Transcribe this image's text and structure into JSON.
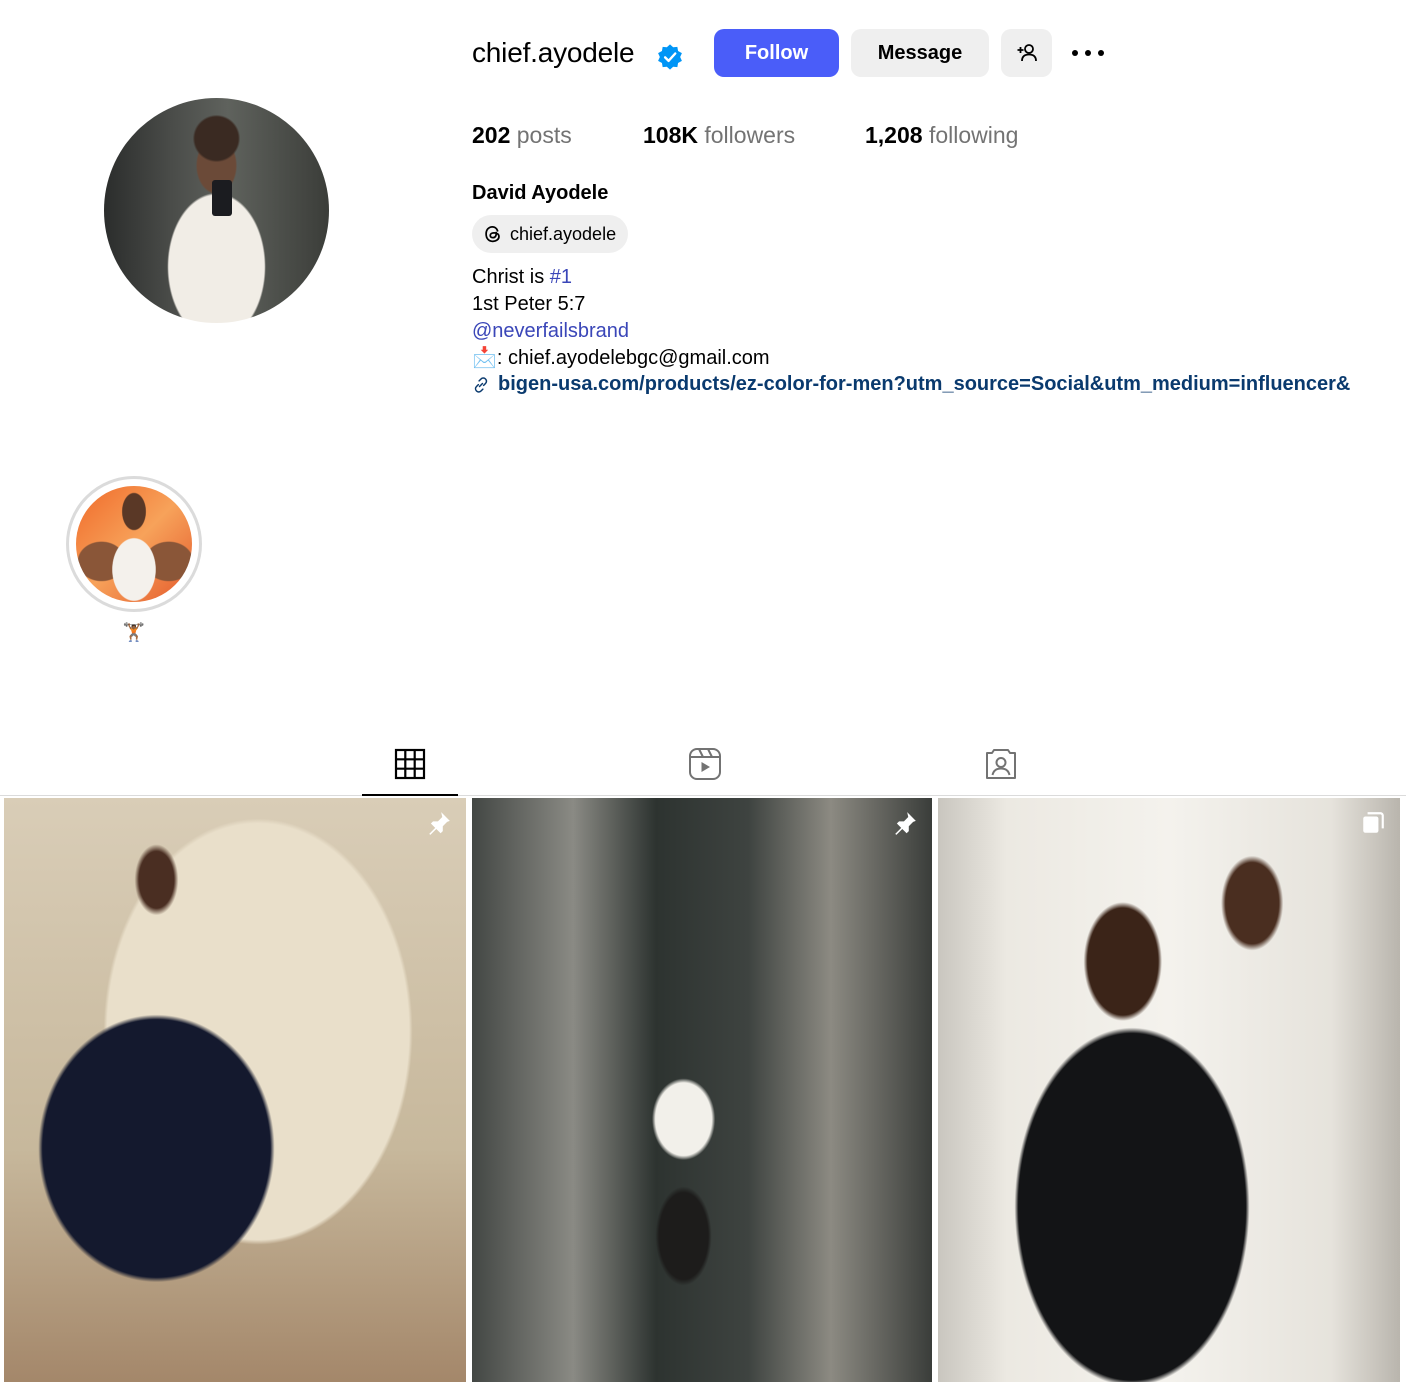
{
  "profile": {
    "username": "chief.ayodele",
    "full_name": "David Ayodele",
    "threads_handle": "chief.ayodele",
    "stats": {
      "posts_count": "202",
      "posts_label": "posts",
      "followers_count": "108K",
      "followers_label": "followers",
      "following_count": "1,208",
      "following_label": "following"
    },
    "bio": {
      "line1_prefix": "Christ is ",
      "line1_hashtag": "#1",
      "line2": "1st Peter 5:7",
      "line3_mention": "@neverfailsbrand",
      "line4_emoji": "📩",
      "line4_text": ": chief.ayodelebgc@gmail.com",
      "link": "bigen-usa.com/products/ez-color-for-men?utm_source=Social&utm_medium=influencer&"
    }
  },
  "actions": {
    "follow_label": "Follow",
    "message_label": "Message"
  },
  "highlights": [
    {
      "label": "🏋🏾"
    }
  ],
  "tabs": [
    {
      "icon": "grid-icon",
      "active": true
    },
    {
      "icon": "reels-icon",
      "active": false
    },
    {
      "icon": "tagged-icon",
      "active": false
    }
  ],
  "posts": [
    {
      "badge": "pin-icon"
    },
    {
      "badge": "pin-icon"
    },
    {
      "badge": "carousel-icon"
    }
  ],
  "colors": {
    "follow_button": "#4a5df9",
    "verified_badge": "#0095f6",
    "link_text": "#0a3a6e",
    "hashtag": "#3a46b8"
  }
}
